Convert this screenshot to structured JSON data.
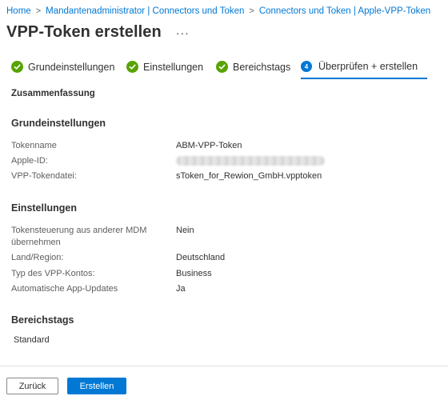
{
  "breadcrumb": [
    "Home",
    "Mandantenadministrator | Connectors und Token",
    "Connectors und Token | Apple-VPP-Token"
  ],
  "breadcrumb_separator": ">",
  "page": {
    "title": "VPP-Token erstellen",
    "more_label": "···"
  },
  "steps": [
    {
      "label": "Grundeinstellungen",
      "status": "done"
    },
    {
      "label": "Einstellungen",
      "status": "done"
    },
    {
      "label": "Bereichstags",
      "status": "done"
    },
    {
      "label": "Überprüfen + erstellen",
      "status": "active",
      "number": "4"
    }
  ],
  "summary_label": "Zusammenfassung",
  "sections": {
    "basics": {
      "title": "Grundeinstellungen",
      "rows": [
        {
          "key": "Tokenname",
          "value": "ABM-VPP-Token"
        },
        {
          "key": "Apple-ID:",
          "value": "",
          "redacted": true
        },
        {
          "key": "VPP-Tokendatei:",
          "value": "sToken_for_Rewion_GmbH.vpptoken"
        }
      ]
    },
    "settings": {
      "title": "Einstellungen",
      "rows": [
        {
          "key": "Tokensteuerung aus anderer MDM übernehmen",
          "value": "Nein"
        },
        {
          "key": "Land/Region:",
          "value": "Deutschland"
        },
        {
          "key": "Typ des VPP-Kontos:",
          "value": "Business"
        },
        {
          "key": "Automatische App-Updates",
          "value": "Ja"
        }
      ]
    },
    "scope": {
      "title": "Bereichstags",
      "value": "Standard"
    }
  },
  "footer": {
    "back_label": "Zurück",
    "create_label": "Erstellen"
  },
  "colors": {
    "accent": "#0078d4",
    "success": "#57a300",
    "text": "#323130",
    "muted": "#605e5c"
  }
}
